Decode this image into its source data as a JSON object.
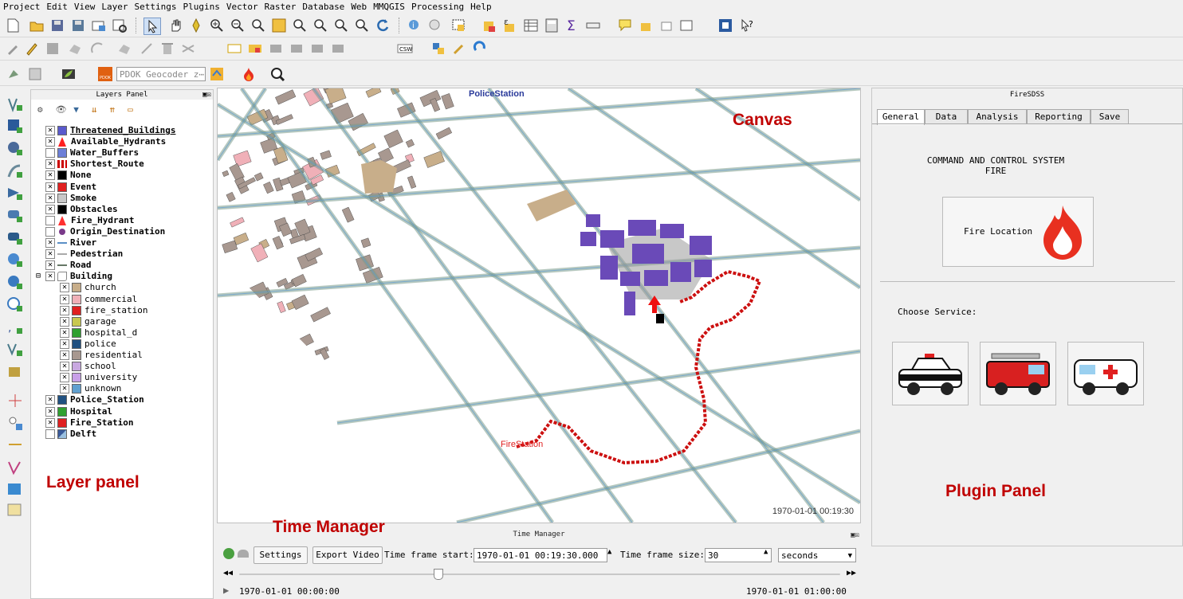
{
  "menu": [
    "Project",
    "Edit",
    "View",
    "Layer",
    "Settings",
    "Plugins",
    "Vector",
    "Raster",
    "Database",
    "Web",
    "MMQGIS",
    "Processing",
    "Help"
  ],
  "toolbar3": {
    "geocoder_placeholder": "PDOK Geocoder z⋯"
  },
  "layers_panel": {
    "title": "Layers Panel",
    "layers": [
      {
        "label": "Threatened_Buildings",
        "checked": true,
        "swatch": "#5a5acd",
        "level": 0,
        "kind": "box"
      },
      {
        "label": "Available_Hydrants",
        "checked": true,
        "swatch": "#ff2020",
        "level": 0,
        "kind": "arrow"
      },
      {
        "label": "Water_Buffers",
        "checked": false,
        "swatch": "#6c7fd8",
        "level": 0,
        "kind": "box"
      },
      {
        "label": "Shortest_Route",
        "checked": true,
        "swatch": "#cc0000",
        "level": 0,
        "kind": "dots"
      },
      {
        "label": "None",
        "checked": true,
        "swatch": "#000000",
        "level": 0,
        "kind": "box"
      },
      {
        "label": "Event",
        "checked": true,
        "swatch": "#e02020",
        "level": 0,
        "kind": "box"
      },
      {
        "label": "Smoke",
        "checked": true,
        "swatch": "#c8c8c8",
        "level": 0,
        "kind": "box"
      },
      {
        "label": "Obstacles",
        "checked": true,
        "swatch": "#000000",
        "level": 0,
        "kind": "box"
      },
      {
        "label": "Fire_Hydrant",
        "checked": false,
        "swatch": "#ff3030",
        "level": 0,
        "kind": "arrow"
      },
      {
        "label": "Origin_Destination",
        "checked": false,
        "swatch": "#7a3a8a",
        "level": 0,
        "kind": "dot"
      },
      {
        "label": "River",
        "checked": true,
        "swatch": "#5b8fc6",
        "level": 0,
        "kind": "line"
      },
      {
        "label": "Pedestrian",
        "checked": true,
        "swatch": "#aaaaaa",
        "level": 0,
        "kind": "line"
      },
      {
        "label": "Road",
        "checked": true,
        "swatch": "#667766",
        "level": 0,
        "kind": "line"
      },
      {
        "label": "Building",
        "checked": true,
        "swatch": "#bbbbbb",
        "level": 0,
        "kind": "poly",
        "expanded": true
      },
      {
        "label": "church",
        "checked": true,
        "swatch": "#c8ae8a",
        "level": 1,
        "kind": "box"
      },
      {
        "label": "commercial",
        "checked": true,
        "swatch": "#f0b0b8",
        "level": 1,
        "kind": "box"
      },
      {
        "label": "fire_station",
        "checked": true,
        "swatch": "#e02020",
        "level": 1,
        "kind": "box"
      },
      {
        "label": "garage",
        "checked": true,
        "swatch": "#c8c850",
        "level": 1,
        "kind": "box"
      },
      {
        "label": "hospital_d",
        "checked": true,
        "swatch": "#30a030",
        "level": 1,
        "kind": "box"
      },
      {
        "label": "police",
        "checked": true,
        "swatch": "#205080",
        "level": 1,
        "kind": "box"
      },
      {
        "label": "residential",
        "checked": true,
        "swatch": "#a89890",
        "level": 1,
        "kind": "box"
      },
      {
        "label": "school",
        "checked": true,
        "swatch": "#c8a8e0",
        "level": 1,
        "kind": "box"
      },
      {
        "label": "university",
        "checked": true,
        "swatch": "#c8a0e8",
        "level": 1,
        "kind": "box"
      },
      {
        "label": "unknown",
        "checked": true,
        "swatch": "#60a0d0",
        "level": 1,
        "kind": "box"
      },
      {
        "label": "Police_Station",
        "checked": true,
        "swatch": "#205080",
        "level": 0,
        "kind": "box"
      },
      {
        "label": "Hospital",
        "checked": true,
        "swatch": "#30a030",
        "level": 0,
        "kind": "box"
      },
      {
        "label": "Fire_Station",
        "checked": true,
        "swatch": "#e02020",
        "level": 0,
        "kind": "box"
      },
      {
        "label": "Delft",
        "checked": false,
        "swatch": "#4a6aa0",
        "level": 0,
        "kind": "raster"
      }
    ]
  },
  "canvas": {
    "timestamp": "1970-01-01 00:19:30",
    "label_police": "PoliceStation",
    "label_fire": "FireStation"
  },
  "annotations": {
    "canvas": "Canvas",
    "layer_panel": "Layer panel",
    "time_manager": "Time Manager",
    "plugin_panel": "Plugin Panel"
  },
  "time_manager": {
    "title": "Time Manager",
    "settings": "Settings",
    "export": "Export Video",
    "start_label": "Time frame start:",
    "start_value": "1970-01-01 00:19:30.000",
    "size_label": "Time frame size:",
    "size_value": "30",
    "unit": "seconds",
    "range_start": "1970-01-01 00:00:00",
    "range_end": "1970-01-01 01:00:00",
    "slider_position": 0.33
  },
  "plugin": {
    "title": "FireSDSS",
    "tabs": [
      "General",
      "Data",
      "Analysis",
      "Reporting",
      "Save"
    ],
    "active_tab": 0,
    "heading_line1": "COMMAND AND CONTROL SYSTEM",
    "heading_line2": "FIRE",
    "fire_button": "Fire Location",
    "choose_service": "Choose Service:",
    "services": [
      "police",
      "fire-truck",
      "ambulance"
    ]
  }
}
